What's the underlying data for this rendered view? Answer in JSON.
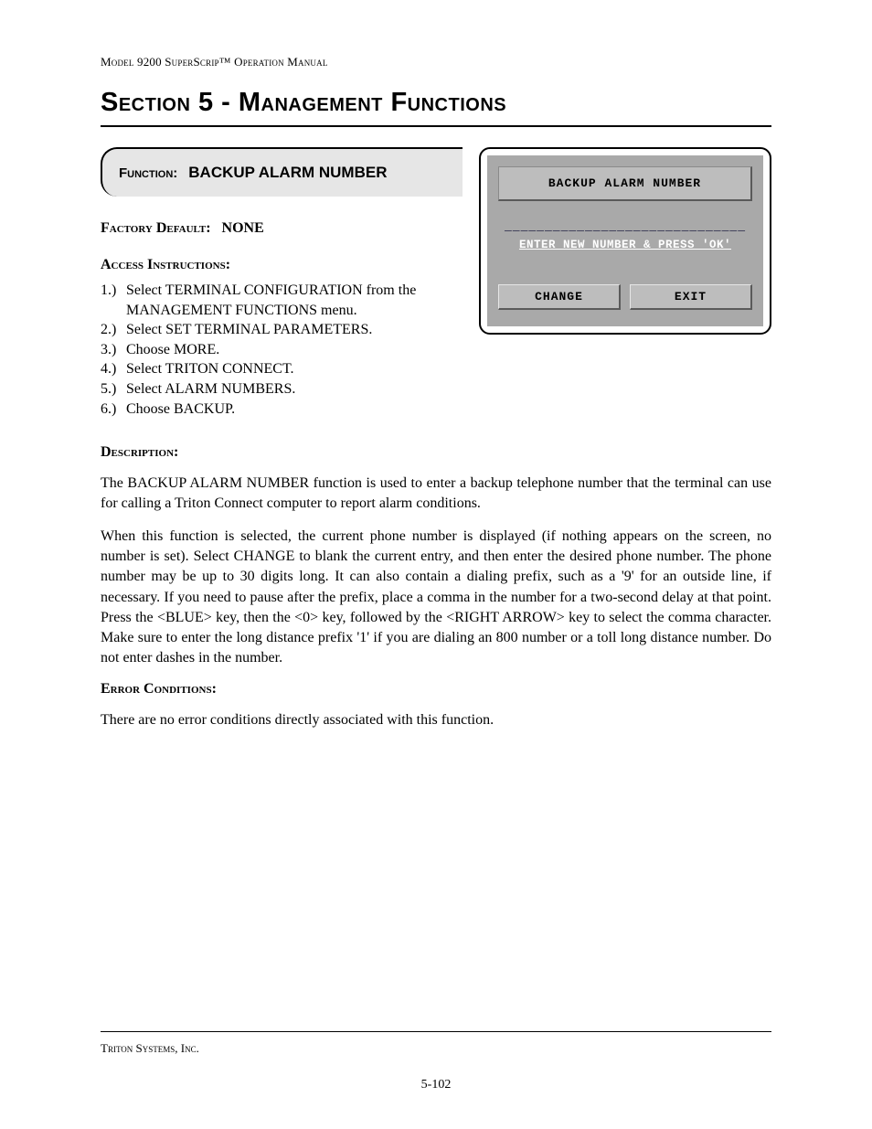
{
  "header": {
    "running": "Model 9200 SuperScrip™ Operation Manual",
    "section_title": "Section 5 - Management Functions"
  },
  "function_box": {
    "label": "Function:",
    "name": "BACKUP ALARM NUMBER"
  },
  "defaults": {
    "label": "Factory Default:",
    "value": "NONE"
  },
  "access": {
    "heading": "Access Instructions:",
    "steps": [
      {
        "n": "1.)",
        "text": "Select TERMINAL CONFIGURATION from the MANAGEMENT FUNCTIONS menu."
      },
      {
        "n": "2.)",
        "text": "Select SET TERMINAL PARAMETERS."
      },
      {
        "n": "3.)",
        "text": "Choose MORE."
      },
      {
        "n": "4.)",
        "text": "Select TRITON CONNECT."
      },
      {
        "n": "5.)",
        "text": "Select ALARM NUMBERS."
      },
      {
        "n": "6.)",
        "text": "Choose BACKUP."
      }
    ]
  },
  "screen": {
    "title": "BACKUP ALARM NUMBER",
    "entry_line": "______________________________",
    "prompt": "ENTER NEW NUMBER & PRESS 'OK'",
    "btn_change": "CHANGE",
    "btn_exit": "EXIT"
  },
  "description": {
    "heading": "Description:",
    "para1": "The BACKUP ALARM NUMBER function is used to enter a backup telephone number that the terminal can use for calling a Triton Connect computer to report alarm conditions.",
    "para2": "When this function is selected, the current phone number is displayed (if nothing appears on the screen, no number is set).  Select CHANGE to blank the current entry, and then enter the desired phone number.  The phone number may be up to 30 digits long.  It can also contain a dialing prefix, such as a '9' for an outside line, if necessary.  If you need to pause after the prefix, place a comma in the number for a two-second delay at that point.  Press the <BLUE> key, then the <0> key, followed by the <RIGHT ARROW> key to select the comma character.  Make sure to enter the long distance prefix '1' if you are dialing an 800 number or a toll long distance number.  Do not enter dashes in the number."
  },
  "errors": {
    "heading": "Error Conditions:",
    "text": "There are no error conditions directly associated with this function."
  },
  "footer": {
    "company": "Triton Systems, Inc.",
    "page": "5-102"
  }
}
